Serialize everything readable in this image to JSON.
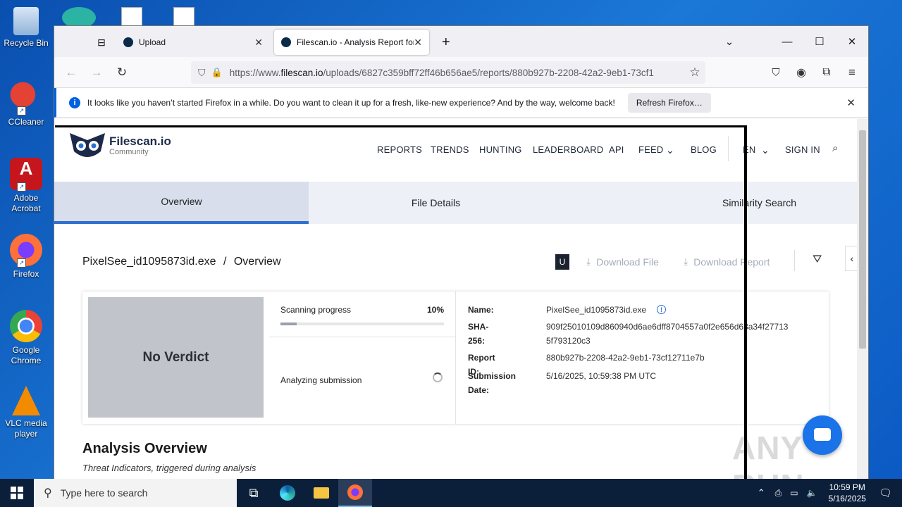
{
  "desktop": {
    "icons": [
      {
        "label": "Recycle Bin",
        "icon": "recycle-bin-icon"
      },
      {
        "label": "CCleaner",
        "icon": "ccleaner-icon"
      },
      {
        "label": "Adobe Acrobat",
        "icon": "adobe-acrobat-icon"
      },
      {
        "label": "Firefox",
        "icon": "firefox-icon"
      },
      {
        "label": "Google Chrome",
        "icon": "chrome-icon"
      },
      {
        "label": "VLC media player",
        "icon": "vlc-icon"
      }
    ]
  },
  "browser": {
    "tabs": [
      {
        "label": "Upload",
        "active": false
      },
      {
        "label": "Filescan.io - Analysis Report for",
        "active": true
      }
    ],
    "url": {
      "prefix": "https://www.",
      "domain": "filescan.io",
      "path": "/uploads/6827c359bff72ff46b656ae5/reports/880b927b-2208-42a2-9eb1-73cf1"
    },
    "notification": {
      "text": "It looks like you haven’t started Firefox in a while. Do you want to clean it up for a fresh, like-new experience? And by the way, welcome back!",
      "button": "Refresh Firefox…"
    }
  },
  "site": {
    "logo_title": "Filescan.io",
    "logo_subtitle": "Community",
    "menu": [
      "REPORTS",
      "TRENDS",
      "HUNTING",
      "LEADERBOARD",
      "API",
      "FEED",
      "BLOG"
    ],
    "language": "EN",
    "sign_in": "SIGN IN",
    "tabs": [
      "Overview",
      "File Details",
      "Similarity Search"
    ],
    "breadcrumb_file": "PixelSee_id1095873id.exe",
    "breadcrumb_sep": "/",
    "breadcrumb_page": "Overview",
    "badge": "U",
    "download_file": "Download File",
    "download_report": "Download Report",
    "verdict": "No Verdict",
    "scan_label": "Scanning progress",
    "scan_percent": "10%",
    "scan_progress": 0.1,
    "analyzing": "Analyzing submission",
    "details": {
      "name_label": "Name:",
      "name_value": "PixelSee_id1095873id.exe",
      "sha_label": "SHA-256:",
      "sha_value": "909f25010109d860940d6ae6dff8704557a0f2e656d63a34f277135f793120c3",
      "report_label": "Report ID:",
      "report_value": "880b927b-2208-42a2-9eb1-73cf12711e7b",
      "date_label": "Submission Date:",
      "date_value": "5/16/2025, 10:59:38 PM UTC"
    },
    "analysis_title": "Analysis Overview",
    "analysis_sub": "Threat Indicators, triggered during analysis"
  },
  "watermark": "ANY RUN",
  "taskbar": {
    "search_placeholder": "Type here to search",
    "time": "10:59 PM",
    "date": "5/16/2025"
  }
}
